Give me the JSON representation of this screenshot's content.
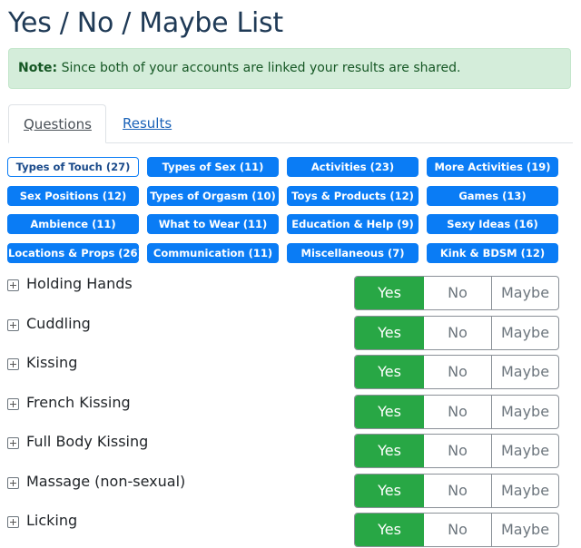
{
  "page": {
    "title": "Yes / No / Maybe List"
  },
  "note": {
    "label": "Note:",
    "text": " Since both of your accounts are linked your results are shared."
  },
  "tabs": [
    {
      "label": "Questions",
      "active": true
    },
    {
      "label": "Results",
      "active": false
    }
  ],
  "categories": [
    {
      "label": "Types of Touch (27)",
      "selected": true
    },
    {
      "label": "Types of Sex (11)"
    },
    {
      "label": "Activities (23)"
    },
    {
      "label": "More Activities (19)"
    },
    {
      "label": "Sex Positions (12)"
    },
    {
      "label": "Types of Orgasm (10)"
    },
    {
      "label": "Toys & Products (12)"
    },
    {
      "label": "Games (13)"
    },
    {
      "label": "Ambience (11)"
    },
    {
      "label": "What to Wear (11)"
    },
    {
      "label": "Education & Help (9)"
    },
    {
      "label": "Sexy Ideas (16)"
    },
    {
      "label": "Locations & Props (26)"
    },
    {
      "label": "Communication (11)"
    },
    {
      "label": "Miscellaneous (7)"
    },
    {
      "label": "Kink & BDSM (12)"
    }
  ],
  "answer_labels": {
    "yes": "Yes",
    "no": "No",
    "maybe": "Maybe"
  },
  "questions": [
    {
      "label": "Holding Hands",
      "answer": "Yes"
    },
    {
      "label": "Cuddling",
      "answer": "Yes"
    },
    {
      "label": "Kissing",
      "answer": "Yes"
    },
    {
      "label": "French Kissing",
      "answer": "Yes"
    },
    {
      "label": "Full Body Kissing",
      "answer": "Yes"
    },
    {
      "label": "Massage (non-sexual)",
      "answer": "Yes"
    },
    {
      "label": "Licking",
      "answer": "Yes"
    }
  ]
}
